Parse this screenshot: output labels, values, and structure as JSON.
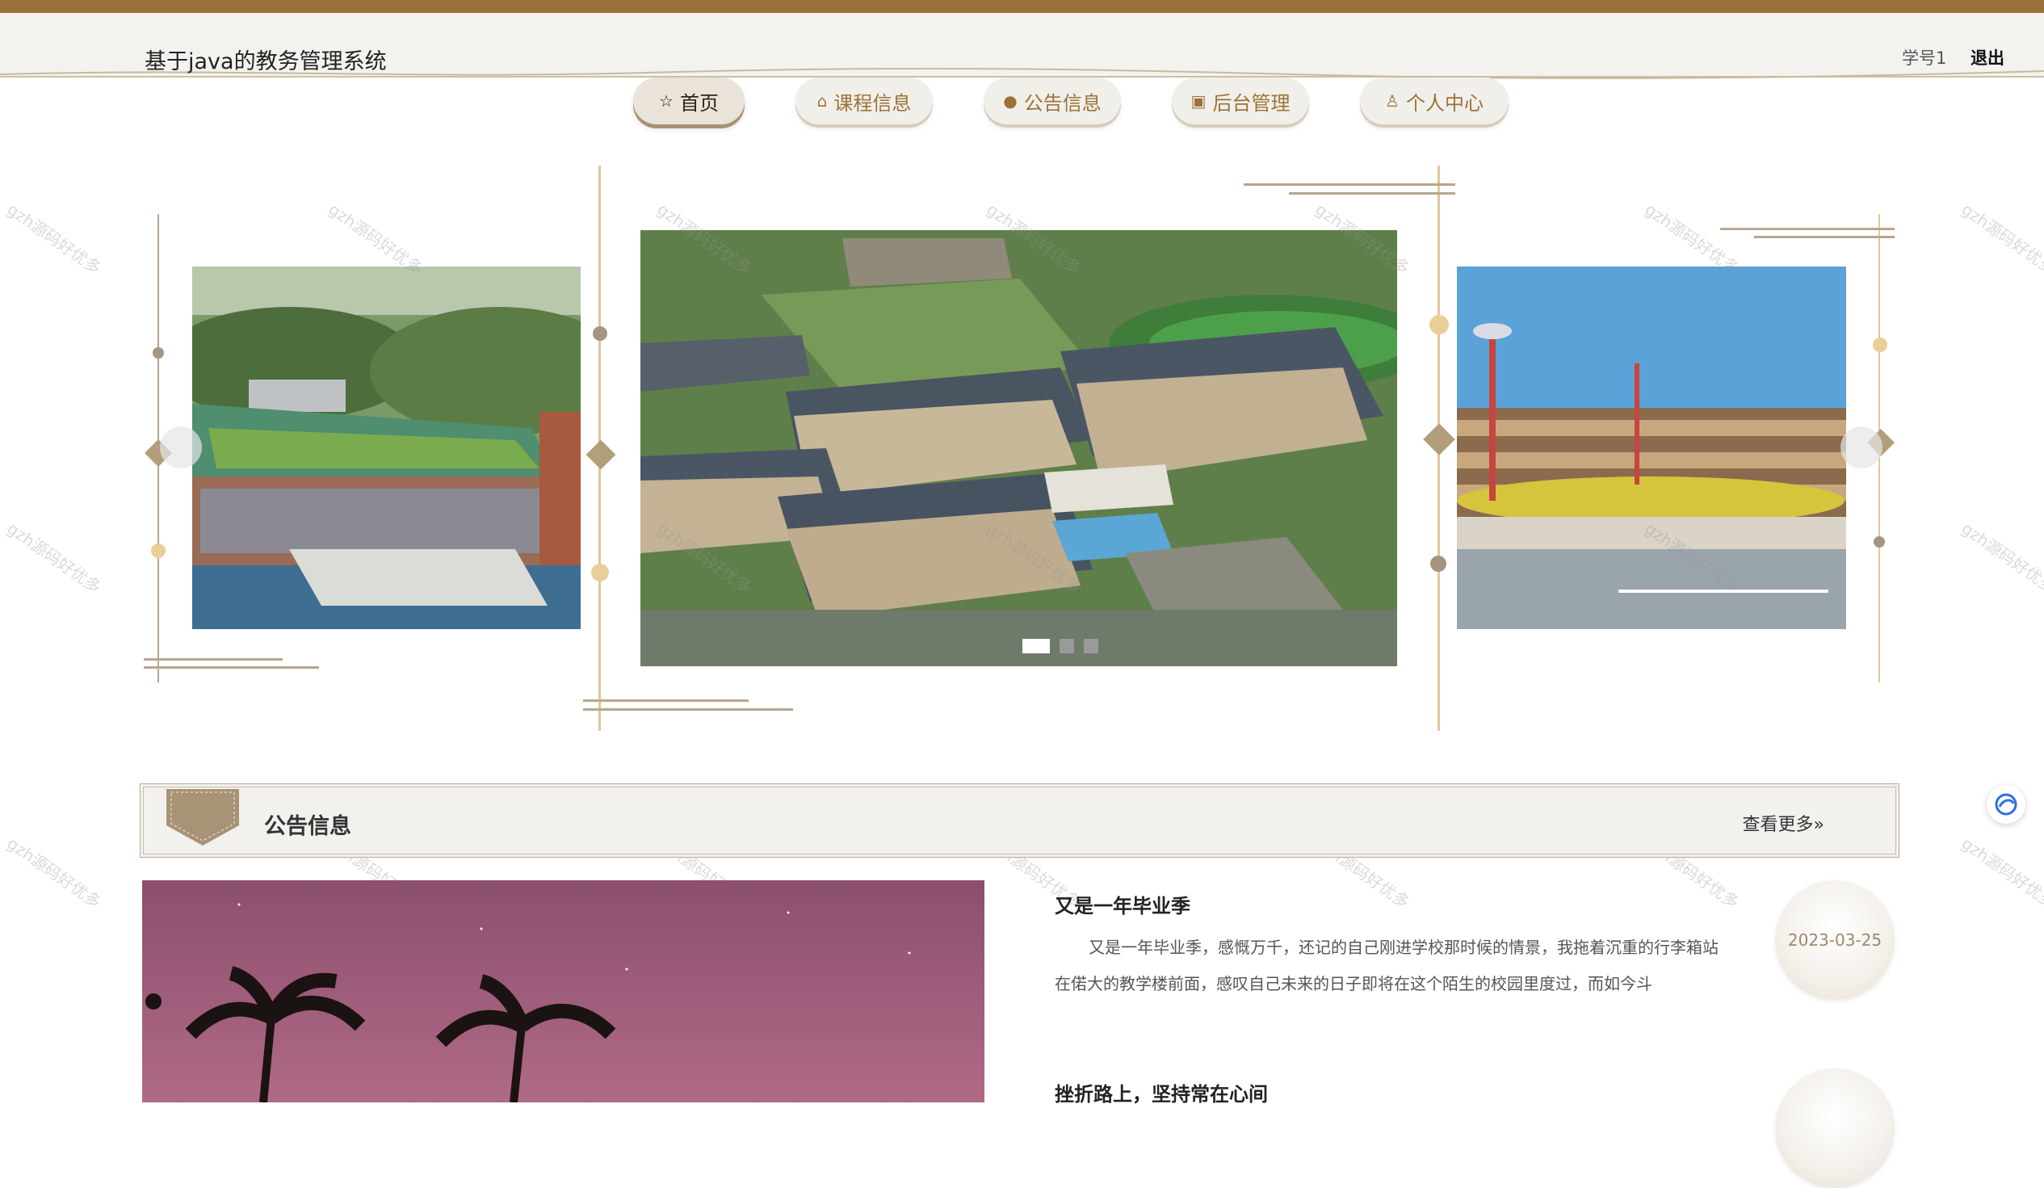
{
  "header": {
    "site_title": "基于java的教务管理系统",
    "user_label": "学号1",
    "logout_label": "退出"
  },
  "nav": {
    "items": [
      {
        "label": "首页",
        "icon": "star-icon",
        "active": true
      },
      {
        "label": "课程信息",
        "icon": "bag-icon",
        "active": false
      },
      {
        "label": "公告信息",
        "icon": "alert-icon",
        "active": false
      },
      {
        "label": "后台管理",
        "icon": "clipboard-icon",
        "active": false
      },
      {
        "label": "个人中心",
        "icon": "user-icon",
        "active": false
      }
    ]
  },
  "carousel": {
    "slides": [
      "campus-library-building",
      "campus-aerial-view",
      "campus-playground-building"
    ],
    "active_index": 0,
    "dot_count": 3
  },
  "watermark_text": "gzh源码好优多",
  "notice": {
    "title": "公告信息",
    "more_label": "查看更多",
    "items": [
      {
        "title": "又是一年毕业季",
        "summary": "又是一年毕业季，感慨万千，还记的自己刚进学校那时候的情景，我拖着沉重的行李箱站在偌大的教学楼前面，感叹自己未来的日子即将在这个陌生的校园里度过，而如今斗",
        "date": "2023-03-25"
      },
      {
        "title": "挫折路上，坚持常在心间",
        "summary": "",
        "date": ""
      }
    ]
  },
  "colors": {
    "brand": "#9b7338",
    "accent": "#b39e7c"
  }
}
